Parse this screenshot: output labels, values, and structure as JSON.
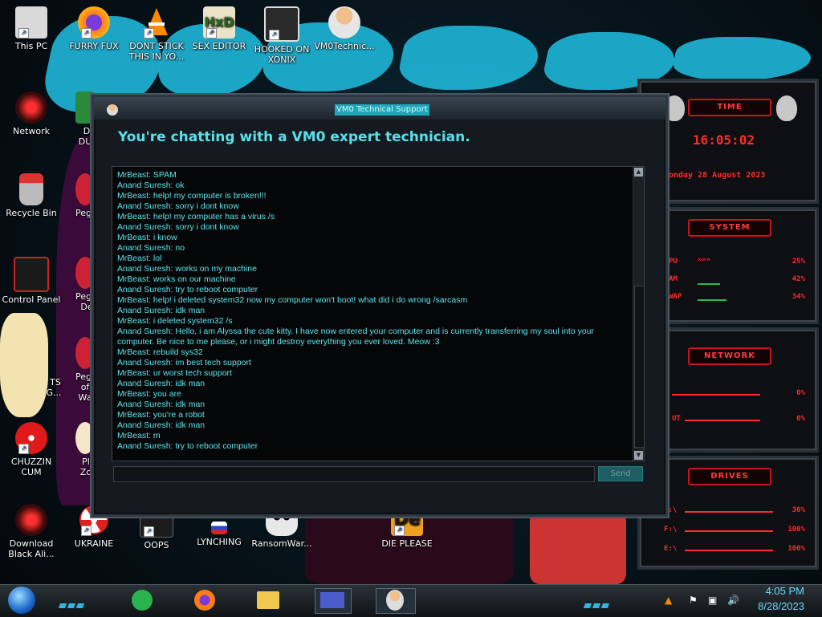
{
  "desktop": {
    "icons": [
      {
        "label": "This PC",
        "icon": "computer-icon"
      },
      {
        "label": "FURRY FUX",
        "icon": "firefox-icon"
      },
      {
        "label": "DONT STICK THIS IN YO...",
        "icon": "vlc-cone-icon"
      },
      {
        "label": "SEX EDITOR",
        "icon": "hex-editor-icon"
      },
      {
        "label": "HOOKED ON XONIX",
        "icon": "xonix-game-icon"
      },
      {
        "label": "VM0Technic...",
        "icon": "technician-icon"
      },
      {
        "label": "Network",
        "icon": "network-icon"
      },
      {
        "label": "Recycle Bin",
        "icon": "recycle-bin-icon"
      },
      {
        "label": "Control Panel",
        "icon": "control-panel-icon"
      },
      {
        "label": "CHUZZIN CUM",
        "icon": "chuzzle-icon"
      },
      {
        "label": "Download Black Ali...",
        "icon": "alienware-icon"
      },
      {
        "label": "UKRAINE",
        "icon": "radiation-icon"
      },
      {
        "label": "OOPS",
        "icon": "oops-icon"
      },
      {
        "label": "LYNCHING",
        "icon": "lynching-icon"
      },
      {
        "label": "RansomWar...",
        "icon": "skull-icon"
      },
      {
        "label": "DIE PLEASE",
        "icon": "de-icon"
      }
    ],
    "partial_labels": {
      "d1": "D",
      "du": "DU",
      "peggl1": "Peggl",
      "peggl2": "Peggl",
      "de": "De",
      "ts": "TS",
      "g": "G...",
      "peggl3": "Peggl",
      "ofwa": "of Wa",
      "pl": "Pl",
      "zo": "Zo"
    }
  },
  "chat_window": {
    "title": "VM0 Technical Support",
    "header": "You're chatting with a VM0 expert technician.",
    "messages": [
      "MrBeast: SPAM",
      "Anand Suresh: ok",
      "MrBeast: help! my computer is broken!!!",
      "Anand Suresh: sorry i dont know",
      "MrBeast: help! my computer  has a virus /s",
      "Anand Suresh: sorry i dont know",
      "MrBeast: i know",
      "Anand Suresh: no",
      "MrBeast: lol",
      "Anand Suresh: works on my machine",
      "MrBeast: works on our machine",
      "Anand Suresh: try to reboot computer",
      "MrBeast: help! i deleted system32 now my computer won't boot! what did i do wrong /sarcasm",
      "Anand Suresh: idk man",
      "MrBeast: i deleted system32 /s",
      "Anand Suresh: Hello, i am Alyssa the cute kitty. I have now entered your computer and is currently transferring my soul into your computer. Be nice to me please, or i might destroy everything you ever loved. Meow :3",
      "MrBeast: rebuild sys32",
      "Anand Suresh: im best tech support",
      "MrBeast: ur worst tech support",
      "Anand Suresh: idk man",
      "MrBeast: you are",
      "Anand Suresh: idk man",
      "MrBeast: you're a robot",
      "Anand Suresh: idk man",
      "MrBeast: m",
      "Anand Suresh: try to reboot computer"
    ],
    "input_value": "",
    "send_label": "Send"
  },
  "gadget": {
    "time_label": "TIME",
    "time": "16:05:02",
    "date": "onday 28 August 2023",
    "system_label": "SYSTEM",
    "cpu_label": "PU",
    "cpu_value": "25%",
    "ram_label": "AM",
    "ram_value": "42%",
    "swap_label": "WAP",
    "swap_value": "34%",
    "network_label": "NETWORK",
    "net_in": "0%",
    "net_out_label": "UT",
    "net_out": "0%",
    "drives_label": "DRIVES",
    "drives": [
      {
        "name": "C:\\",
        "value": "36%"
      },
      {
        "name": "F:\\",
        "value": "100%"
      },
      {
        "name": "E:\\",
        "value": "100%"
      }
    ]
  },
  "taskbar": {
    "apps": [
      "start-orb",
      "feedly-icon",
      "firefox-icon",
      "file-explorer-icon",
      "presentation-icon",
      "technician-icon"
    ],
    "time": "4:05 PM",
    "date": "8/28/2023"
  },
  "colors": {
    "accent": "#1fb6d8",
    "chat_text": "#5fe6ee",
    "gadget_red": "#ff2a2a"
  }
}
